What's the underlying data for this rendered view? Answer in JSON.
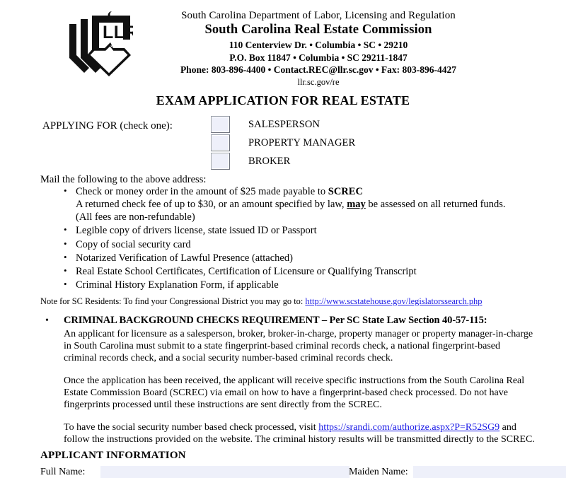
{
  "header": {
    "logo_alt": "SC LLR logo",
    "department": "South Carolina Department of Labor, Licensing and Regulation",
    "commission": "South Carolina Real Estate Commission",
    "address_line1": "110 Centerview Dr. • Columbia • SC • 29210",
    "address_line2": "P.O. Box 11847 • Columbia • SC 29211-1847",
    "contact_line": "Phone: 803-896-4400 • Contact.REC@llr.sc.gov • Fax: 803-896-4427",
    "website": "llr.sc.gov/re"
  },
  "title": "EXAM APPLICATION FOR REAL ESTATE",
  "applying_for": {
    "label": "APPLYING FOR (check one):",
    "options": [
      {
        "label": "SALESPERSON",
        "checked": false
      },
      {
        "label": "PROPERTY MANAGER",
        "checked": false
      },
      {
        "label": "BROKER",
        "checked": false
      }
    ]
  },
  "mail_section": {
    "intro": "Mail the following to the above address:",
    "items": [
      {
        "text_before": "Check or money order  in the amount of $25 made payable to ",
        "bold": "SCREC",
        "text_after": "",
        "sub_lines": [
          {
            "before": "A returned check fee of up to $30, or an amount specified by law, ",
            "bold_underline": "may",
            "after": " be assessed on all returned funds."
          },
          {
            "plain": " (All fees are non-refundable)"
          }
        ]
      },
      {
        "text_before": "Legible copy of drivers license, state issued ID or Passport",
        "bold": "",
        "text_after": "",
        "sub_lines": []
      },
      {
        "text_before": "Copy of social security card",
        "bold": "",
        "text_after": "",
        "sub_lines": []
      },
      {
        "text_before": "Notarized Verification of Lawful Presence (attached)",
        "bold": "",
        "text_after": "",
        "sub_lines": []
      },
      {
        "text_before": "Real Estate School Certificates, Certification of Licensure or Qualifying Transcript",
        "bold": "",
        "text_after": "",
        "sub_lines": []
      },
      {
        "text_before": "Criminal History Explanation Form, if applicable",
        "bold": "",
        "text_after": "",
        "sub_lines": []
      }
    ]
  },
  "note": {
    "text": "Note for SC Residents: To find your Congressional District you may go to: ",
    "link_text": "http://www.scstatehouse.gov/legislatorssearch.php",
    "link_color": "#1a1ae6"
  },
  "criminal_background": {
    "heading": "CRIMINAL BACKGROUND CHECKS REQUIREMENT – Per SC State Law Section 40-57-115:",
    "paragraph1": "An applicant for licensure as a salesperson, broker, broker-in-charge, property manager or property manager-in-charge in South Carolina must submit to a state fingerprint-based criminal records check, a national fingerprint-based criminal records check, and a social security number-based criminal records check.",
    "paragraph2": "Once the application has been received, the applicant will receive specific instructions from the South Carolina Real Estate Commission Board (SCREC) via email on how to have a fingerprint-based check processed. Do not have fingerprints processed until these instructions are sent directly from the SCREC.",
    "paragraph3_before": "To have the social security number based check processed, visit ",
    "paragraph3_link": "https://srandi.com/authorize.aspx?P=R52SG9",
    "paragraph3_after": " and follow the instructions provided on the website. The criminal history results will be transmitted directly to the SCREC."
  },
  "applicant_information": {
    "heading": "APPLICANT INFORMATION",
    "fields": [
      {
        "label": "Full Name:",
        "value": "",
        "placeholder": ""
      },
      {
        "label": "Maiden Name:",
        "value": "",
        "placeholder": ""
      }
    ]
  },
  "colors": {
    "field_fill": "#eef0fa",
    "checkbox_fill": "#eef0fa",
    "checkbox_border": "#70757f",
    "link": "#1a1ae6",
    "text": "#000000",
    "page_background": "#ffffff"
  }
}
